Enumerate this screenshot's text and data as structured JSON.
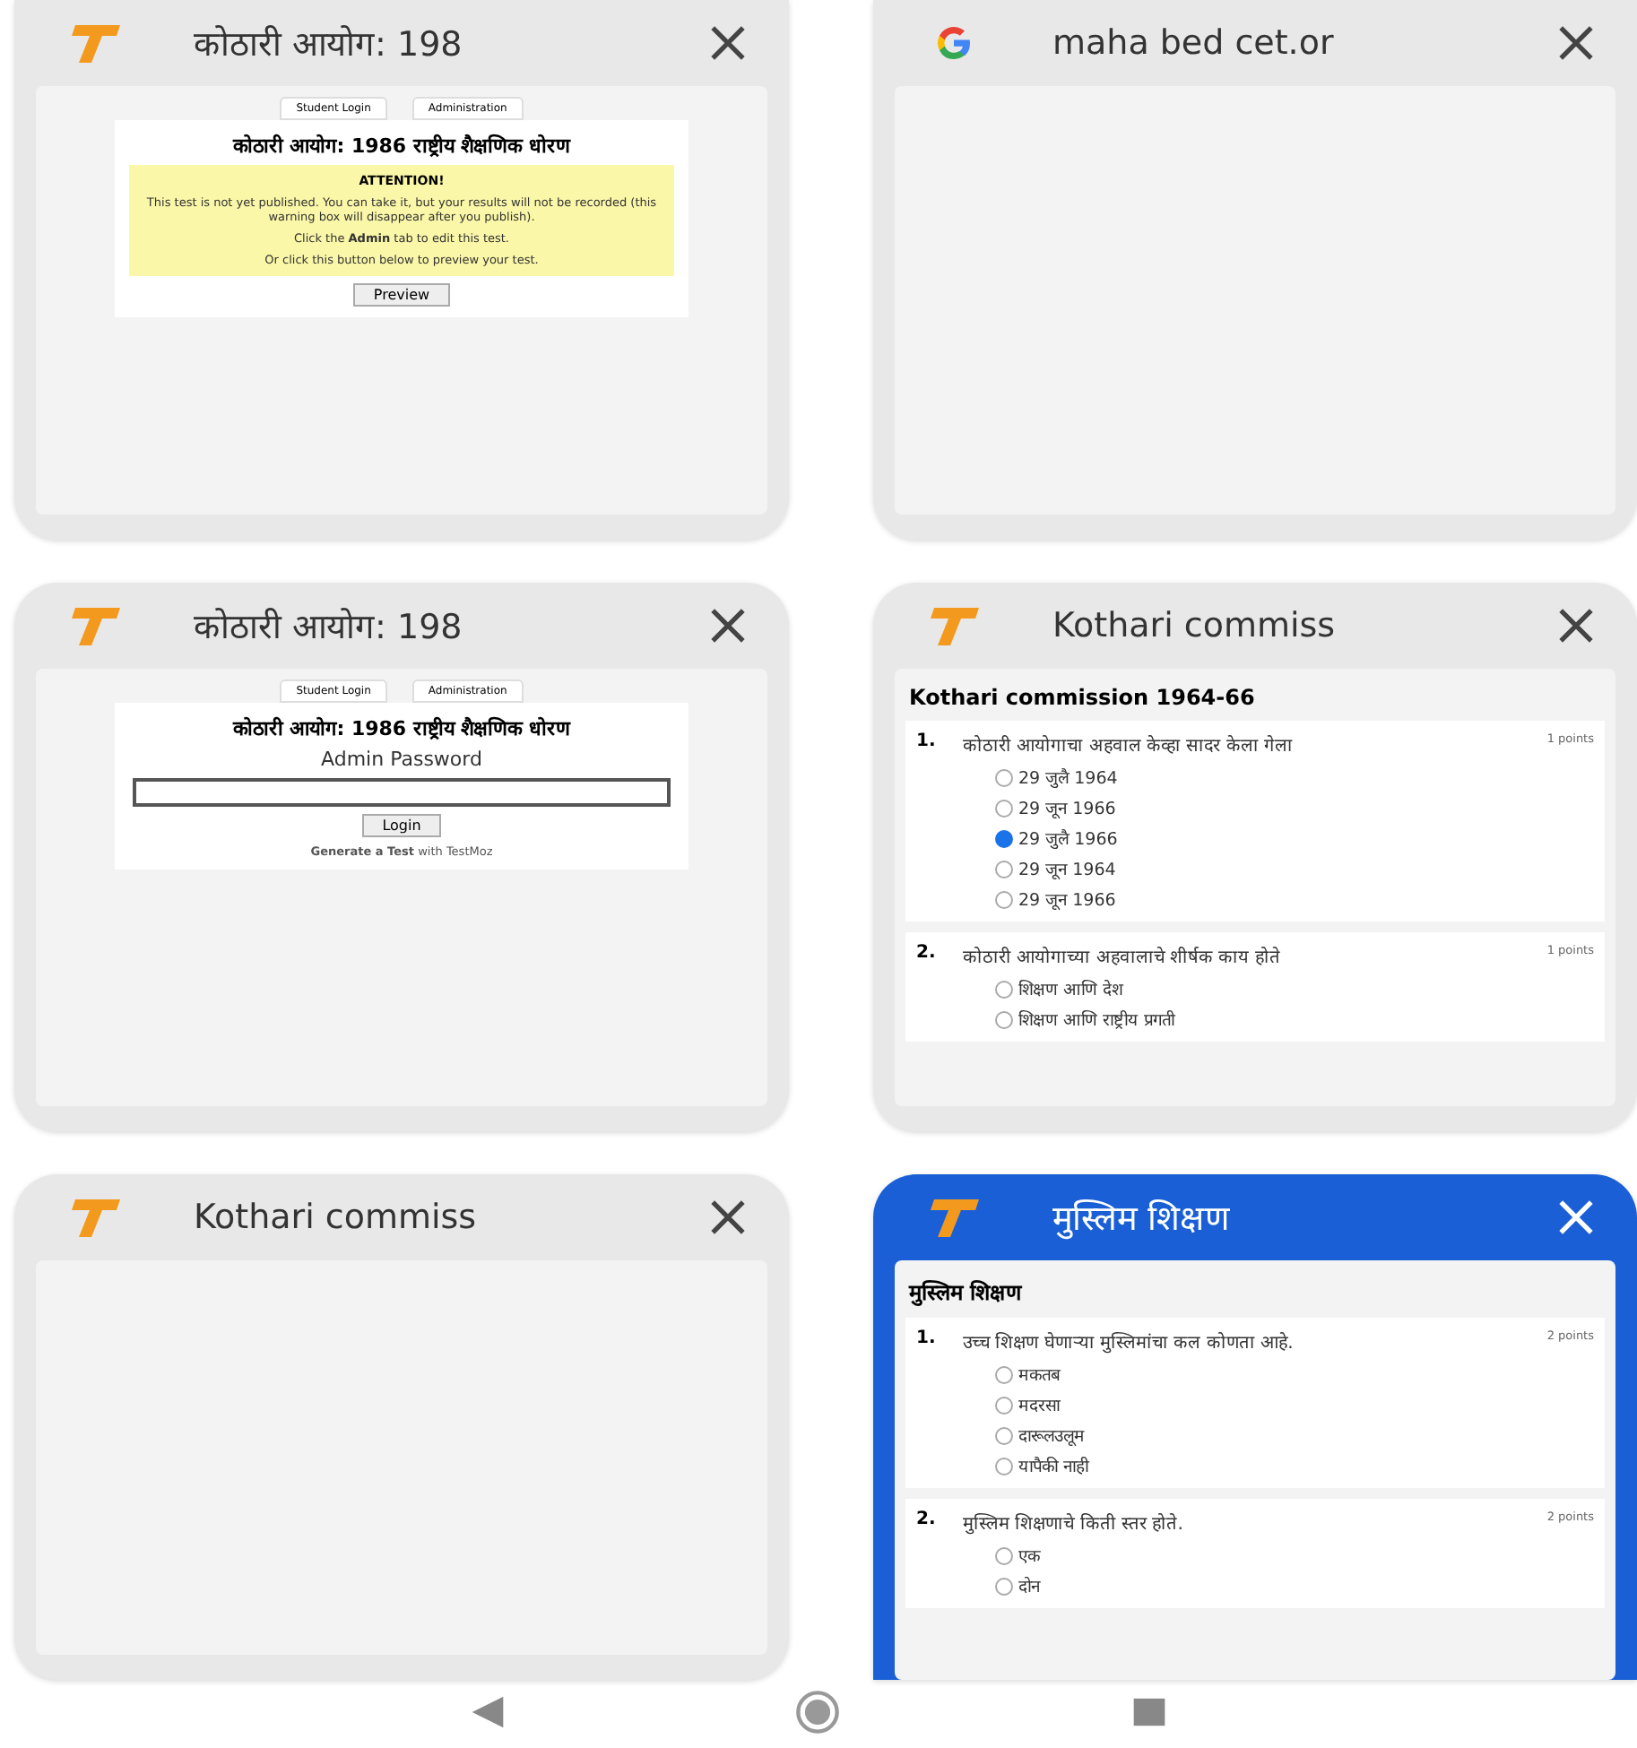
{
  "tabs": [
    {
      "kind": "preview",
      "title": "कोठारी आयोग: 198",
      "selected": false,
      "page": {
        "tabs": [
          "Student Login",
          "Administration"
        ],
        "heading": "कोठारी आयोग: 1986 राष्ट्रीय शैक्षणिक धोरण",
        "notice_title": "ATTENTION!",
        "notice": [
          "This test is not yet published. You can take it, but your results will not be recorded (this warning box will disappear after you publish).",
          "Click the **Admin** tab to edit this test.",
          "Or click this button below to preview your test."
        ],
        "button": "Preview"
      }
    },
    {
      "kind": "blank",
      "title": "maha bed cet.or",
      "selected": false
    },
    {
      "kind": "login",
      "title": "कोठारी आयोग: 198",
      "selected": false,
      "page": {
        "tabs": [
          "Student Login",
          "Administration"
        ],
        "heading": "कोठारी आयोग: 1986 राष्ट्रीय शैक्षणिक धोरण",
        "label": "Admin Password",
        "button": "Login",
        "footer": "**Generate a Test** with TestMoz"
      }
    },
    {
      "kind": "quiz",
      "title": "Kothari commiss",
      "selected": false,
      "page": {
        "heading": "Kothari commission 1964-66",
        "questions": [
          {
            "number": "1.",
            "text": "कोठारी आयोगाचा अहवाल केव्हा सादर केला गेला",
            "points": "1 points",
            "options": [
              {
                "label": "29 जुलै 1964",
                "selected": false
              },
              {
                "label": "29 जून 1966",
                "selected": false
              },
              {
                "label": "29 जुलै 1966",
                "selected": true
              },
              {
                "label": "29 जून 1964",
                "selected": false
              },
              {
                "label": "29 जून 1966",
                "selected": false
              }
            ]
          },
          {
            "number": "2.",
            "text": "कोठारी आयोगाच्या अहवालाचे शीर्षक काय होते",
            "points": "1 points",
            "options": [
              {
                "label": "शिक्षण आणि देश",
                "selected": false
              },
              {
                "label": "शिक्षण आणि राष्ट्रीय प्रगती",
                "selected": false
              }
            ]
          }
        ]
      }
    },
    {
      "kind": "blank",
      "title": "Kothari commiss",
      "selected": false
    },
    {
      "kind": "quiz",
      "title": "मुस्लिम शिक्षण",
      "selected": true,
      "page": {
        "heading": "मुस्लिम शिक्षण",
        "questions": [
          {
            "number": "1.",
            "text": "उच्च शिक्षण घेणाऱ्या मुस्लिमांचा कल कोणता आहे.",
            "points": "2 points",
            "options": [
              {
                "label": "मकतब",
                "selected": false
              },
              {
                "label": "मदरसा",
                "selected": false
              },
              {
                "label": "दारूलउलूम",
                "selected": false
              },
              {
                "label": "यापैकी नाही",
                "selected": false
              }
            ]
          },
          {
            "number": "2.",
            "text": "मुस्लिम शिक्षणाचे किती स्तर होते.",
            "points": "2 points",
            "options": [
              {
                "label": "एक",
                "selected": false
              },
              {
                "label": "दोन",
                "selected": false
              }
            ]
          }
        ]
      }
    }
  ]
}
